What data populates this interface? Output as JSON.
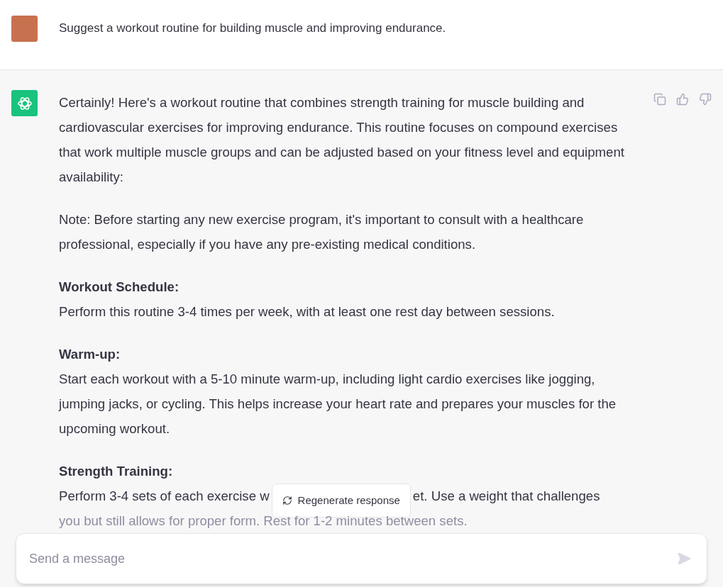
{
  "user_message": {
    "text": "Suggest a workout routine for building muscle and improving endurance."
  },
  "assistant_message": {
    "blocks": [
      {
        "kind": "paragraph",
        "text": "Certainly! Here's a workout routine that combines strength training for muscle building and cardiovascular exercises for improving endurance. This routine focuses on compound exercises that work multiple muscle groups and can be adjusted based on your fitness level and equipment availability:"
      },
      {
        "kind": "paragraph",
        "text": "Note: Before starting any new exercise program, it's important to consult with a healthcare professional, especially if you have any pre-existing medical conditions."
      },
      {
        "kind": "section",
        "heading": "Workout Schedule:",
        "text": "Perform this routine 3-4 times per week, with at least one rest day between sessions."
      },
      {
        "kind": "section",
        "heading": "Warm-up:",
        "text": "Start each workout with a 5-10 minute warm-up, including light cardio exercises like jogging, jumping jacks, or cycling. This helps increase your heart rate and prepares your muscles for the upcoming workout."
      },
      {
        "kind": "section",
        "heading": "Strength Training:"
      }
    ],
    "covered_line": {
      "before": "Perform 3-4 sets of each exercise w",
      "after": "et. Use a weight that challenges"
    },
    "faded_line": "you but still allows for proper form. Rest for 1-2 minutes between sets."
  },
  "regenerate_button": {
    "label": "Regenerate response"
  },
  "composer": {
    "placeholder": "Send a message"
  }
}
